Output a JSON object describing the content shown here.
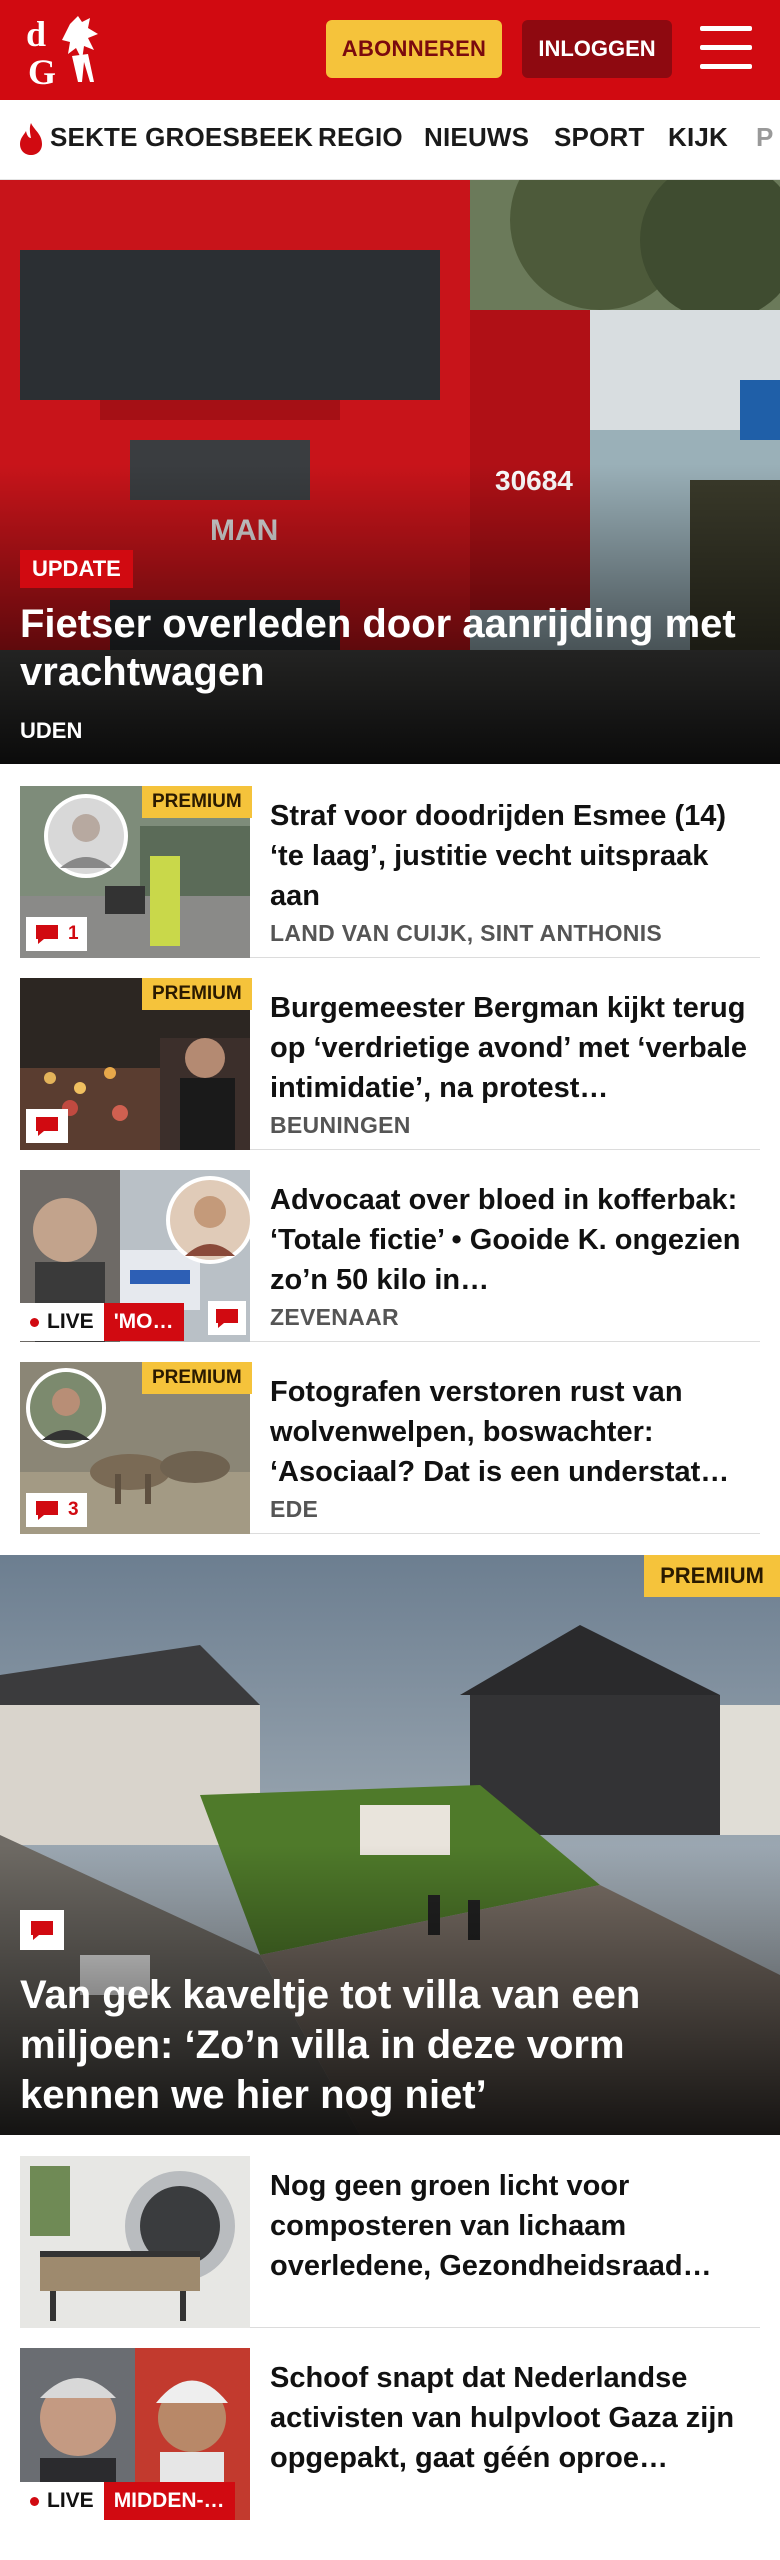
{
  "header": {
    "logo_text": "dG",
    "subscribe_label": "ABONNEREN",
    "login_label": "INLOGGEN",
    "brand_color": "#d10a11"
  },
  "nav": {
    "items": [
      {
        "label": "SEKTE GROESBEEK",
        "icon": "flame-icon"
      },
      {
        "label": "REGIO"
      },
      {
        "label": "NIEUWS"
      },
      {
        "label": "SPORT"
      },
      {
        "label": "KIJK"
      },
      {
        "label": "P"
      }
    ]
  },
  "hero": {
    "badge": "UPDATE",
    "title": "Fietser overleden door aanrijding met vrachtwagen",
    "place": "UDEN"
  },
  "articles": [
    {
      "title": "Straf voor doodrijden Esmee (14) ‘te laag’, justitie vecht uitspraak aan",
      "place": "LAND VAN CUIJK, SINT ANTHONIS",
      "premium": "PREMIUM",
      "comments": "1"
    },
    {
      "title": "Burgemeester Bergman kijkt terug op ‘verdrietige avond’ met ‘verbale intimidatie’, na protest…",
      "place": "BEUNINGEN",
      "premium": "PREMIUM",
      "comments": ""
    },
    {
      "title": "Advocaat over bloed in kofferbak: ‘Totale fictie’ • Gooide K. ongezien zo’n 50 kilo in…",
      "place": "ZEVENAAR",
      "live": "LIVE",
      "live_topic": "'MO…"
    },
    {
      "title": "Fotografen verstoren rust van wolvenwelpen, boswachter: ‘Asociaal? Dat is een understat…",
      "place": "EDE",
      "premium": "PREMIUM",
      "comments": "3"
    }
  ],
  "feature": {
    "premium": "PREMIUM",
    "title": "Van gek kaveltje tot villa van een miljoen: ‘Zo’n villa in deze vorm kennen we hier nog niet’"
  },
  "articles2": [
    {
      "title": "Nog geen groen licht voor composteren van lichaam overledene, Gezondheidsraad…"
    },
    {
      "title": "Schoof snapt dat Nederlandse activisten van hulpvloot Gaza zijn opgepakt, gaat géén oproe…",
      "live": "LIVE",
      "live_topic": "MIDDEN-…"
    }
  ]
}
